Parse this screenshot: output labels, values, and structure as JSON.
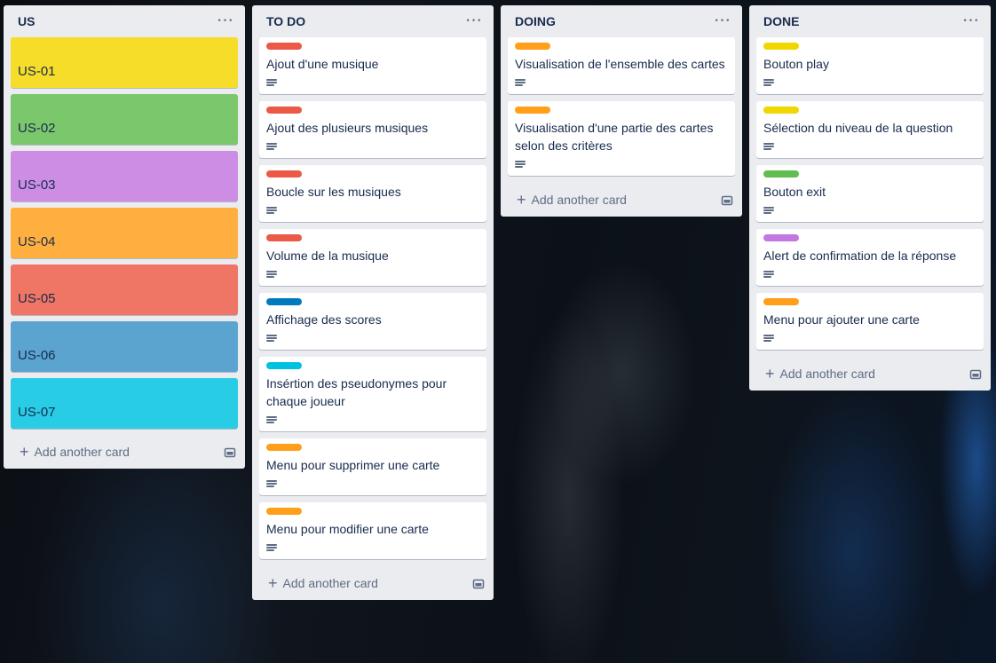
{
  "lists": [
    {
      "title": "US",
      "add_label": "Add another card",
      "us_cards": [
        {
          "title": "US-01",
          "color": "#f5dd29"
        },
        {
          "title": "US-02",
          "color": "#7bc86c"
        },
        {
          "title": "US-03",
          "color": "#cd8de5"
        },
        {
          "title": "US-04",
          "color": "#ffaf3f"
        },
        {
          "title": "US-05",
          "color": "#ef7564"
        },
        {
          "title": "US-06",
          "color": "#5ba4cf"
        },
        {
          "title": "US-07",
          "color": "#29cce5"
        }
      ]
    },
    {
      "title": "TO DO",
      "add_label": "Add another card",
      "cards": [
        {
          "title": "Ajout d'une musique",
          "label_color": "#eb5a46"
        },
        {
          "title": "Ajout des plusieurs musiques",
          "label_color": "#eb5a46"
        },
        {
          "title": "Boucle sur les musiques",
          "label_color": "#eb5a46"
        },
        {
          "title": "Volume de la musique",
          "label_color": "#eb5a46"
        },
        {
          "title": "Affichage des scores",
          "label_color": "#0079bf"
        },
        {
          "title": "Insértion des pseudonymes pour chaque joueur",
          "label_color": "#00c2e0"
        },
        {
          "title": "Menu pour supprimer une carte",
          "label_color": "#ff9f1a"
        },
        {
          "title": "Menu pour modifier une carte",
          "label_color": "#ff9f1a"
        }
      ]
    },
    {
      "title": "DOING",
      "add_label": "Add another card",
      "cards": [
        {
          "title": "Visualisation de l'ensemble des cartes",
          "label_color": "#ff9f1a"
        },
        {
          "title": "Visualisation d'une partie des cartes selon des critères",
          "label_color": "#ff9f1a"
        }
      ]
    },
    {
      "title": "DONE",
      "add_label": "Add another card",
      "cards": [
        {
          "title": "Bouton play",
          "label_color": "#f2d600"
        },
        {
          "title": "Sélection du niveau de la question",
          "label_color": "#f2d600"
        },
        {
          "title": "Bouton exit",
          "label_color": "#61bd4f"
        },
        {
          "title": "Alert de confirmation de la réponse",
          "label_color": "#c377e0"
        },
        {
          "title": "Menu pour ajouter une carte",
          "label_color": "#ff9f1a"
        }
      ]
    }
  ],
  "icons": {
    "list_menu": "ellipsis-icon",
    "description": "description-icon",
    "add": "plus-icon",
    "template": "card-template-icon"
  },
  "colors": {
    "list_bg": "#ebecf0",
    "text": "#172b4d",
    "muted": "#5e6c84"
  }
}
